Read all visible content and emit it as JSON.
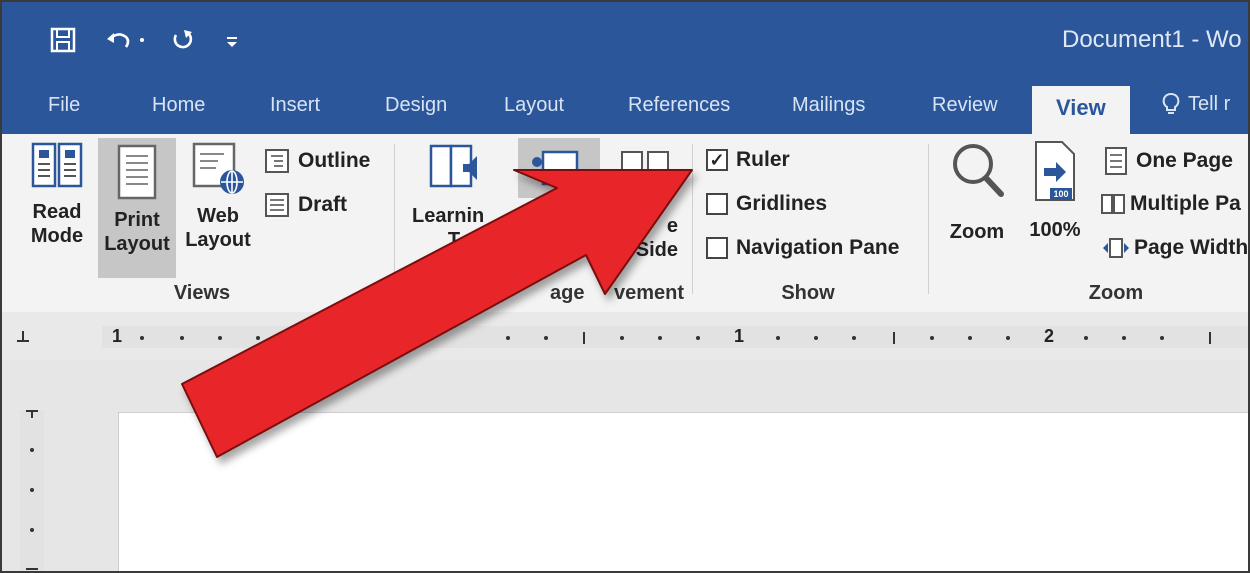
{
  "window": {
    "title": "Document1  -  Wo"
  },
  "quick_access": {
    "save_icon": "save-icon",
    "undo_icon": "undo-icon",
    "redo_icon": "redo-icon"
  },
  "tabs": [
    "File",
    "Home",
    "Insert",
    "Design",
    "Layout",
    "References",
    "Mailings",
    "Review",
    "View"
  ],
  "tell_me": "Tell r",
  "ribbon": {
    "views": {
      "label": "Views",
      "read_mode": [
        "Read",
        "Mode"
      ],
      "print_layout": [
        "Print",
        "Layout"
      ],
      "web_layout": [
        "Web",
        "Layout"
      ],
      "outline": "Outline",
      "draft": "Draft"
    },
    "immersive": {
      "learning_tools": [
        "Learnin",
        "T"
      ]
    },
    "page_movement": {
      "label_left": "age",
      "label_right": "vement",
      "side_to_side": [
        "e",
        "Side"
      ]
    },
    "show": {
      "label": "Show",
      "ruler": {
        "label": "Ruler",
        "checked": true
      },
      "gridlines": {
        "label": "Gridlines",
        "checked": false
      },
      "navigation_pane": {
        "label": "Navigation Pane",
        "checked": false
      }
    },
    "zoom": {
      "label": "Zoom",
      "zoom": "Zoom",
      "hundred": "100%",
      "hundred_badge": "100",
      "one_page": "One Page",
      "multiple_pages": "Multiple Pa",
      "page_width": "Page Width"
    }
  },
  "ruler": {
    "marks": [
      "1",
      "1",
      "2"
    ]
  },
  "colors": {
    "brand": "#2b579a",
    "arrow": "#e8262a",
    "ribbon": "#f3f3f3"
  }
}
